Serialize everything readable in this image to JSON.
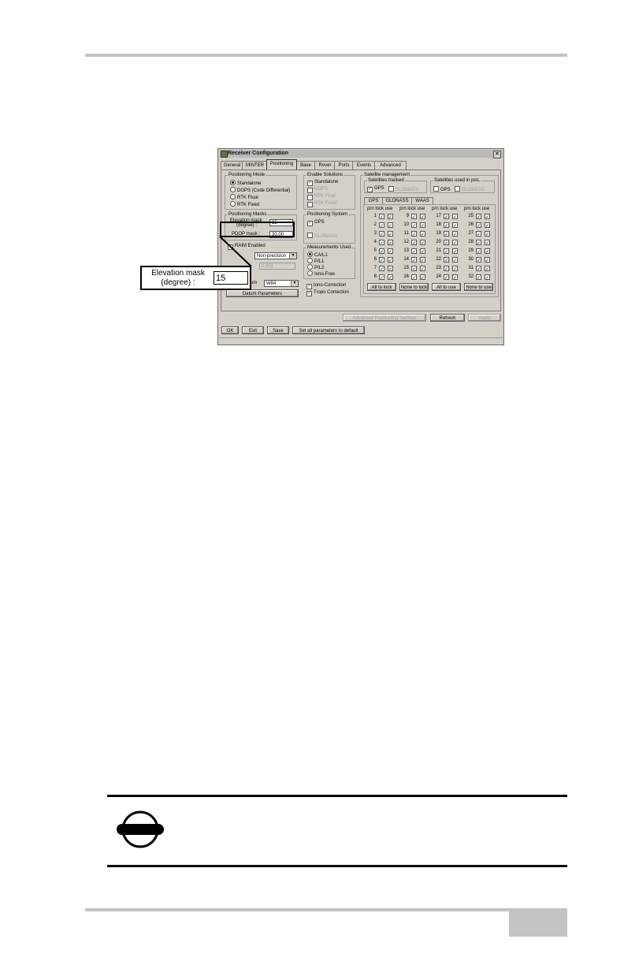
{
  "dialog": {
    "title": "Receiver Configuration",
    "close_glyph": "×",
    "tabs": [
      "General",
      "MINTER",
      "Positioning",
      "Base",
      "Rover",
      "Ports",
      "Events",
      "Advanced"
    ],
    "positioning_mode": {
      "title": "Positioning Mode",
      "options": [
        "Standalone",
        "DGPS (Code Differential)",
        "RTK Float",
        "RTK Fixed"
      ],
      "selected": "Standalone"
    },
    "enable_solutions": {
      "title": "Enable Solutions",
      "options": [
        "Standalone",
        "DGPS",
        "RTK Float",
        "RTK Fixed"
      ]
    },
    "positioning_masks": {
      "title": "Positioning Masks",
      "elevation_label_1": "Elevation mask",
      "elevation_label_2": "(degree) :",
      "elevation_value": "15",
      "pdop_label": "PDOP mask :",
      "pdop_value": "30.00"
    },
    "raim": {
      "label": "RAIM Enabled",
      "mode_value": "Non-precision",
      "secondary_value": "0.001"
    },
    "current_datum": {
      "label": "Current Datum",
      "value": "W84",
      "button": "Datum Parameters"
    },
    "positioning_system": {
      "title": "Positioning System",
      "gps": "GPS",
      "glonass": "GLONASS"
    },
    "measurements_used": {
      "title": "Measurements Used",
      "options": [
        "CA/L1",
        "P/L1",
        "P/L2",
        "Iono-Free"
      ],
      "selected": "CA/L1"
    },
    "corrections": [
      "Iono-Correction",
      "Tropo Correction"
    ],
    "satellite_management": {
      "title": "Satellite management",
      "tracked_title": "Satellites tracked",
      "used_title": "Satellites used in pos.",
      "gps": "GPS",
      "glonass": "GLONASS",
      "subtabs": [
        "GPS",
        "GLONASS",
        "WAAS"
      ],
      "col_header": "prn lock use",
      "columns": [
        [
          "1",
          "2",
          "3",
          "4",
          "5",
          "6",
          "7",
          "8"
        ],
        [
          "9",
          "10",
          "11",
          "12",
          "13",
          "14",
          "15",
          "16"
        ],
        [
          "17",
          "18",
          "19",
          "20",
          "21",
          "22",
          "23",
          "24"
        ],
        [
          "25",
          "26",
          "27",
          "28",
          "29",
          "30",
          "31",
          "32"
        ]
      ],
      "buttons": [
        "All to lock",
        "None to lock",
        "All to use",
        "None to use"
      ]
    },
    "action_buttons": {
      "advanced": "Advanced Positioning Settings",
      "refresh": "Refresh",
      "apply": "Apply"
    },
    "bottom_buttons": [
      "OK",
      "Exit",
      "Save",
      "Set all parameters to default"
    ]
  },
  "callout": {
    "label_1": "Elevation mask",
    "label_2": "(degree) :",
    "value": "15"
  },
  "glyphs": {
    "check": "✓",
    "arrow_down": "▼"
  }
}
